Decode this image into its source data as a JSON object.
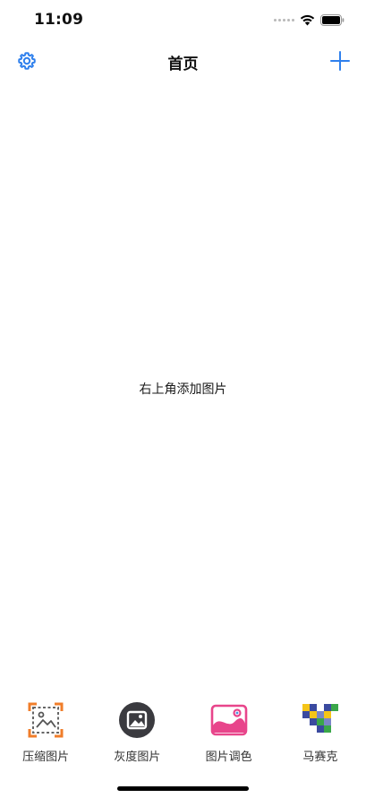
{
  "status_bar": {
    "time": "11:09"
  },
  "nav": {
    "title": "首页",
    "settings_icon": "gear-icon",
    "add_icon": "plus-icon",
    "accent_color": "#2f80ed"
  },
  "main": {
    "empty_hint": "右上角添加图片"
  },
  "tab_bar": {
    "items": [
      {
        "label": "压缩图片",
        "icon": "compress-image-icon"
      },
      {
        "label": "灰度图片",
        "icon": "grayscale-image-icon"
      },
      {
        "label": "图片调色",
        "icon": "color-adjust-image-icon"
      },
      {
        "label": "马赛克",
        "icon": "mosaic-icon"
      }
    ]
  }
}
